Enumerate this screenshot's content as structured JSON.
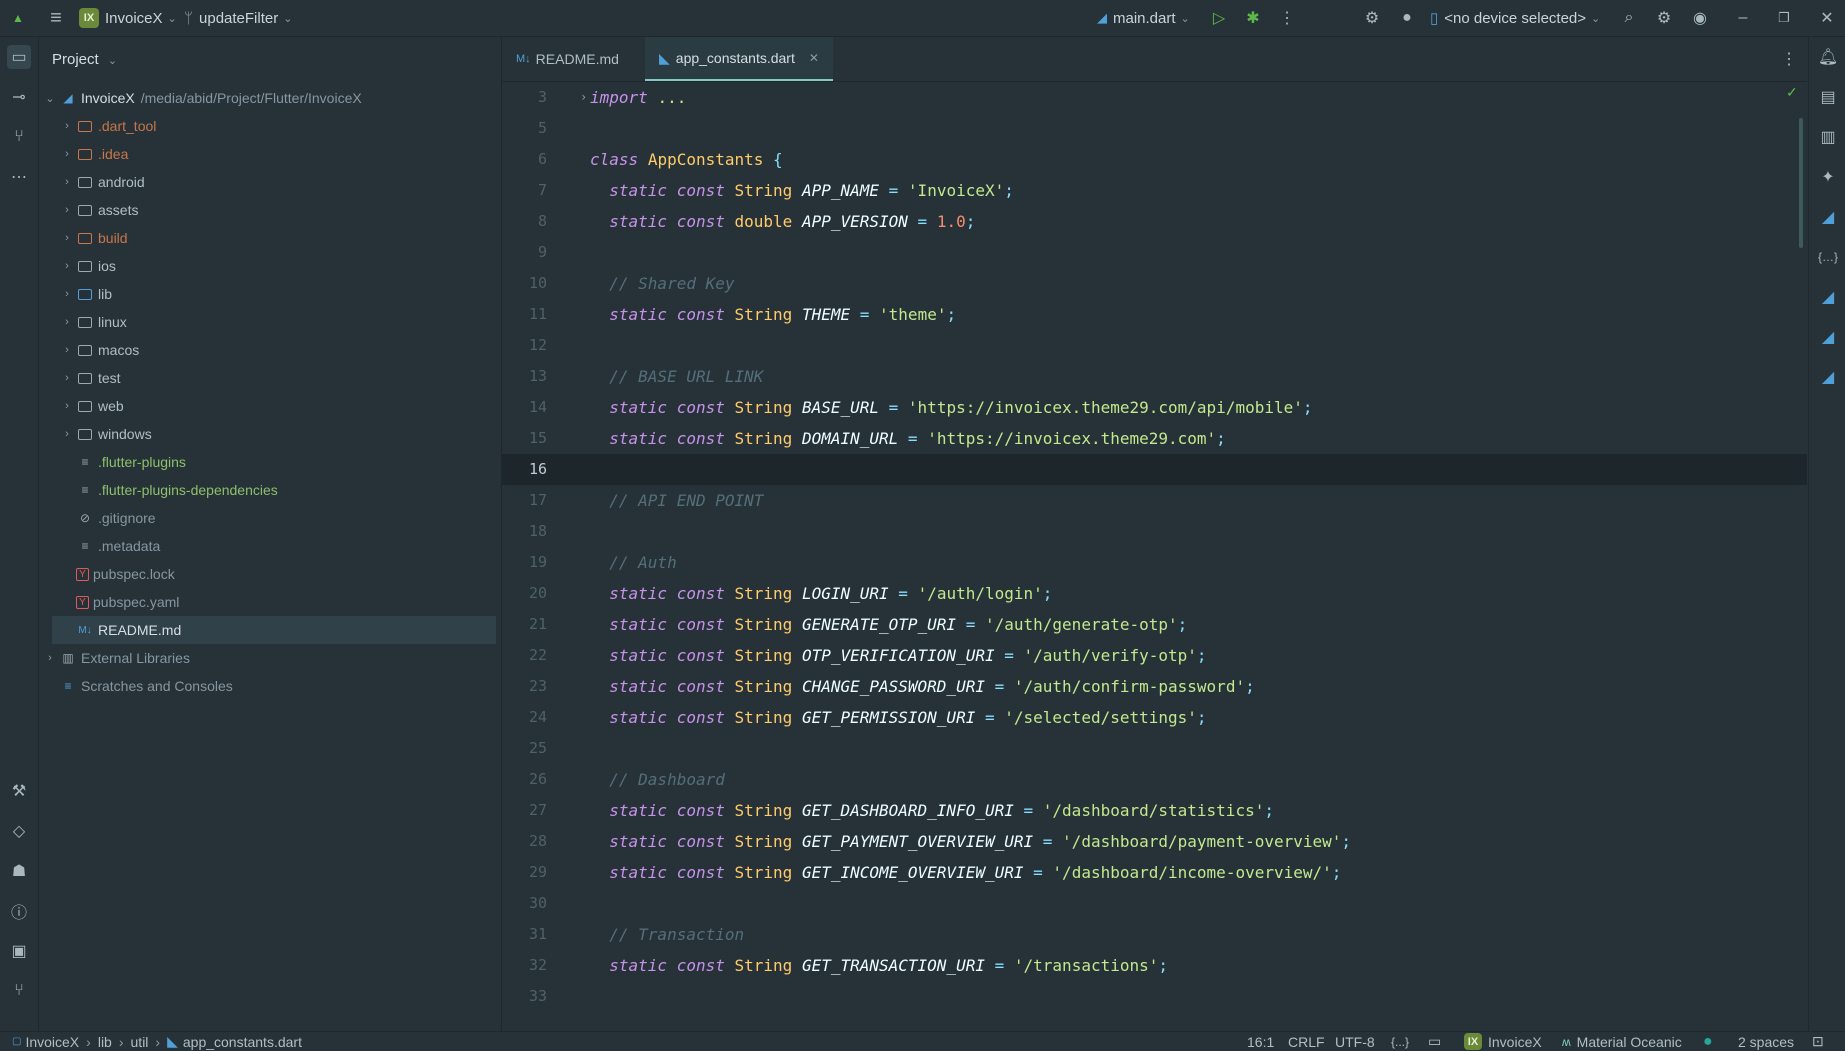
{
  "titlebar": {
    "project_badge": "IX",
    "project_name": "InvoiceX",
    "branch": "updateFilter",
    "run_config": "main.dart",
    "device": "<no device selected>"
  },
  "project_panel": {
    "header": "Project",
    "root": {
      "name": "InvoiceX",
      "path": "/media/abid/Project/Flutter/InvoiceX"
    },
    "items": [
      {
        "name": ".dart_tool",
        "kind": "folder",
        "color": "orange"
      },
      {
        "name": ".idea",
        "kind": "folder",
        "color": "orange"
      },
      {
        "name": "android",
        "kind": "folder",
        "color": "plain"
      },
      {
        "name": "assets",
        "kind": "folder",
        "color": "plain"
      },
      {
        "name": "build",
        "kind": "folder",
        "color": "orange"
      },
      {
        "name": "ios",
        "kind": "folder",
        "color": "plain"
      },
      {
        "name": "lib",
        "kind": "folder",
        "color": "blue"
      },
      {
        "name": "linux",
        "kind": "folder",
        "color": "plain"
      },
      {
        "name": "macos",
        "kind": "folder",
        "color": "plain"
      },
      {
        "name": "test",
        "kind": "folder",
        "color": "plain"
      },
      {
        "name": "web",
        "kind": "folder",
        "color": "plain"
      },
      {
        "name": "windows",
        "kind": "folder",
        "color": "plain"
      },
      {
        "name": ".flutter-plugins",
        "kind": "file",
        "color": "green"
      },
      {
        "name": ".flutter-plugins-dependencies",
        "kind": "file",
        "color": "green"
      },
      {
        "name": ".gitignore",
        "kind": "file",
        "color": "gray"
      },
      {
        "name": ".metadata",
        "kind": "file",
        "color": "gray"
      },
      {
        "name": "pubspec.lock",
        "kind": "yaml",
        "color": "gray"
      },
      {
        "name": "pubspec.yaml",
        "kind": "yaml",
        "color": "gray"
      },
      {
        "name": "README.md",
        "kind": "md",
        "color": "light"
      }
    ],
    "external_libraries": "External Libraries",
    "scratches": "Scratches and Consoles"
  },
  "tabs": [
    {
      "label": "README.md",
      "icon": "markdown-icon",
      "active": false
    },
    {
      "label": "app_constants.dart",
      "icon": "dart-icon",
      "active": true
    }
  ],
  "code_lines": [
    {
      "n": "3",
      "tokens": [
        [
          "kw",
          "import"
        ],
        [
          "pl",
          " "
        ],
        [
          "st",
          "..."
        ]
      ]
    },
    {
      "n": "5",
      "tokens": []
    },
    {
      "n": "6",
      "tokens": [
        [
          "kw",
          "class"
        ],
        [
          "pl",
          " "
        ],
        [
          "ty",
          "AppConstants"
        ],
        [
          "pl",
          " "
        ],
        [
          "op",
          "{"
        ]
      ]
    },
    {
      "n": "7",
      "tokens": [
        [
          "pl",
          "  "
        ],
        [
          "kw",
          "static const"
        ],
        [
          "pl",
          " "
        ],
        [
          "ty",
          "String"
        ],
        [
          "pl",
          " "
        ],
        [
          "cn",
          "APP_NAME"
        ],
        [
          "pl",
          " "
        ],
        [
          "op",
          "="
        ],
        [
          "pl",
          " "
        ],
        [
          "st",
          "'InvoiceX'"
        ],
        [
          "op",
          ";"
        ]
      ]
    },
    {
      "n": "8",
      "tokens": [
        [
          "pl",
          "  "
        ],
        [
          "kw",
          "static const"
        ],
        [
          "pl",
          " "
        ],
        [
          "ty",
          "double"
        ],
        [
          "pl",
          " "
        ],
        [
          "cn",
          "APP_VERSION"
        ],
        [
          "pl",
          " "
        ],
        [
          "op",
          "="
        ],
        [
          "pl",
          " "
        ],
        [
          "nu",
          "1.0"
        ],
        [
          "op",
          ";"
        ]
      ]
    },
    {
      "n": "9",
      "tokens": []
    },
    {
      "n": "10",
      "tokens": [
        [
          "pl",
          "  "
        ],
        [
          "cm",
          "// Shared Key"
        ]
      ]
    },
    {
      "n": "11",
      "tokens": [
        [
          "pl",
          "  "
        ],
        [
          "kw",
          "static const"
        ],
        [
          "pl",
          " "
        ],
        [
          "ty",
          "String"
        ],
        [
          "pl",
          " "
        ],
        [
          "cn",
          "THEME"
        ],
        [
          "pl",
          " "
        ],
        [
          "op",
          "="
        ],
        [
          "pl",
          " "
        ],
        [
          "st",
          "'theme'"
        ],
        [
          "op",
          ";"
        ]
      ]
    },
    {
      "n": "12",
      "tokens": []
    },
    {
      "n": "13",
      "tokens": [
        [
          "pl",
          "  "
        ],
        [
          "cm",
          "// BASE URL LINK"
        ]
      ]
    },
    {
      "n": "14",
      "tokens": [
        [
          "pl",
          "  "
        ],
        [
          "kw",
          "static const"
        ],
        [
          "pl",
          " "
        ],
        [
          "ty",
          "String"
        ],
        [
          "pl",
          " "
        ],
        [
          "cn",
          "BASE_URL"
        ],
        [
          "pl",
          " "
        ],
        [
          "op",
          "="
        ],
        [
          "pl",
          " "
        ],
        [
          "st",
          "'https://invoicex.theme29.com/api/mobile'"
        ],
        [
          "op",
          ";"
        ]
      ]
    },
    {
      "n": "15",
      "tokens": [
        [
          "pl",
          "  "
        ],
        [
          "kw",
          "static const"
        ],
        [
          "pl",
          " "
        ],
        [
          "ty",
          "String"
        ],
        [
          "pl",
          " "
        ],
        [
          "cn",
          "DOMAIN_URL"
        ],
        [
          "pl",
          " "
        ],
        [
          "op",
          "="
        ],
        [
          "pl",
          " "
        ],
        [
          "st",
          "'https://invoicex.theme29.com'"
        ],
        [
          "op",
          ";"
        ]
      ]
    },
    {
      "n": "16",
      "tokens": [],
      "current": true
    },
    {
      "n": "17",
      "tokens": [
        [
          "pl",
          "  "
        ],
        [
          "cm",
          "// API END POINT"
        ]
      ]
    },
    {
      "n": "18",
      "tokens": []
    },
    {
      "n": "19",
      "tokens": [
        [
          "pl",
          "  "
        ],
        [
          "cm",
          "// Auth"
        ]
      ]
    },
    {
      "n": "20",
      "tokens": [
        [
          "pl",
          "  "
        ],
        [
          "kw",
          "static const"
        ],
        [
          "pl",
          " "
        ],
        [
          "ty",
          "String"
        ],
        [
          "pl",
          " "
        ],
        [
          "cn",
          "LOGIN_URI"
        ],
        [
          "pl",
          " "
        ],
        [
          "op",
          "="
        ],
        [
          "pl",
          " "
        ],
        [
          "st",
          "'/auth/login'"
        ],
        [
          "op",
          ";"
        ]
      ]
    },
    {
      "n": "21",
      "tokens": [
        [
          "pl",
          "  "
        ],
        [
          "kw",
          "static const"
        ],
        [
          "pl",
          " "
        ],
        [
          "ty",
          "String"
        ],
        [
          "pl",
          " "
        ],
        [
          "cn",
          "GENERATE_OTP_URI"
        ],
        [
          "pl",
          " "
        ],
        [
          "op",
          "="
        ],
        [
          "pl",
          " "
        ],
        [
          "st",
          "'/auth/generate-otp'"
        ],
        [
          "op",
          ";"
        ]
      ]
    },
    {
      "n": "22",
      "tokens": [
        [
          "pl",
          "  "
        ],
        [
          "kw",
          "static const"
        ],
        [
          "pl",
          " "
        ],
        [
          "ty",
          "String"
        ],
        [
          "pl",
          " "
        ],
        [
          "cn",
          "OTP_VERIFICATION_URI"
        ],
        [
          "pl",
          " "
        ],
        [
          "op",
          "="
        ],
        [
          "pl",
          " "
        ],
        [
          "st",
          "'/auth/verify-otp'"
        ],
        [
          "op",
          ";"
        ]
      ]
    },
    {
      "n": "23",
      "tokens": [
        [
          "pl",
          "  "
        ],
        [
          "kw",
          "static const"
        ],
        [
          "pl",
          " "
        ],
        [
          "ty",
          "String"
        ],
        [
          "pl",
          " "
        ],
        [
          "cn",
          "CHANGE_PASSWORD_URI"
        ],
        [
          "pl",
          " "
        ],
        [
          "op",
          "="
        ],
        [
          "pl",
          " "
        ],
        [
          "st",
          "'/auth/confirm-password'"
        ],
        [
          "op",
          ";"
        ]
      ]
    },
    {
      "n": "24",
      "tokens": [
        [
          "pl",
          "  "
        ],
        [
          "kw",
          "static const"
        ],
        [
          "pl",
          " "
        ],
        [
          "ty",
          "String"
        ],
        [
          "pl",
          " "
        ],
        [
          "cn",
          "GET_PERMISSION_URI"
        ],
        [
          "pl",
          " "
        ],
        [
          "op",
          "="
        ],
        [
          "pl",
          " "
        ],
        [
          "st",
          "'/selected/settings'"
        ],
        [
          "op",
          ";"
        ]
      ]
    },
    {
      "n": "25",
      "tokens": []
    },
    {
      "n": "26",
      "tokens": [
        [
          "pl",
          "  "
        ],
        [
          "cm",
          "// Dashboard"
        ]
      ]
    },
    {
      "n": "27",
      "tokens": [
        [
          "pl",
          "  "
        ],
        [
          "kw",
          "static const"
        ],
        [
          "pl",
          " "
        ],
        [
          "ty",
          "String"
        ],
        [
          "pl",
          " "
        ],
        [
          "cn",
          "GET_DASHBOARD_INFO_URI"
        ],
        [
          "pl",
          " "
        ],
        [
          "op",
          "="
        ],
        [
          "pl",
          " "
        ],
        [
          "st",
          "'/dashboard/statistics'"
        ],
        [
          "op",
          ";"
        ]
      ]
    },
    {
      "n": "28",
      "tokens": [
        [
          "pl",
          "  "
        ],
        [
          "kw",
          "static const"
        ],
        [
          "pl",
          " "
        ],
        [
          "ty",
          "String"
        ],
        [
          "pl",
          " "
        ],
        [
          "cn",
          "GET_PAYMENT_OVERVIEW_URI"
        ],
        [
          "pl",
          " "
        ],
        [
          "op",
          "="
        ],
        [
          "pl",
          " "
        ],
        [
          "st",
          "'/dashboard/payment-overview'"
        ],
        [
          "op",
          ";"
        ]
      ]
    },
    {
      "n": "29",
      "tokens": [
        [
          "pl",
          "  "
        ],
        [
          "kw",
          "static const"
        ],
        [
          "pl",
          " "
        ],
        [
          "ty",
          "String"
        ],
        [
          "pl",
          " "
        ],
        [
          "cn",
          "GET_INCOME_OVERVIEW_URI"
        ],
        [
          "pl",
          " "
        ],
        [
          "op",
          "="
        ],
        [
          "pl",
          " "
        ],
        [
          "st",
          "'/dashboard/income-overview/'"
        ],
        [
          "op",
          ";"
        ]
      ]
    },
    {
      "n": "30",
      "tokens": []
    },
    {
      "n": "31",
      "tokens": [
        [
          "pl",
          "  "
        ],
        [
          "cm",
          "// Transaction"
        ]
      ]
    },
    {
      "n": "32",
      "tokens": [
        [
          "pl",
          "  "
        ],
        [
          "kw",
          "static const"
        ],
        [
          "pl",
          " "
        ],
        [
          "ty",
          "String"
        ],
        [
          "pl",
          " "
        ],
        [
          "cn",
          "GET_TRANSACTION_URI"
        ],
        [
          "pl",
          " "
        ],
        [
          "op",
          "="
        ],
        [
          "pl",
          " "
        ],
        [
          "st",
          "'/transactions'"
        ],
        [
          "op",
          ";"
        ]
      ]
    },
    {
      "n": "33",
      "tokens": []
    }
  ],
  "breadcrumbs": [
    "InvoiceX",
    "lib",
    "util",
    "app_constants.dart"
  ],
  "statusbar": {
    "position": "16:1",
    "line_ending": "CRLF",
    "encoding": "UTF-8",
    "context": "{...}",
    "project_badge": "IX",
    "project": "InvoiceX",
    "theme": "Material Oceanic",
    "indent": "2 spaces"
  },
  "colors": {
    "background": "#263238",
    "accent": "#80cbc4",
    "keyword": "#c792ea",
    "type": "#ffcb6b",
    "string": "#c3e88d",
    "number": "#f78c6c",
    "comment": "#546e7a"
  }
}
